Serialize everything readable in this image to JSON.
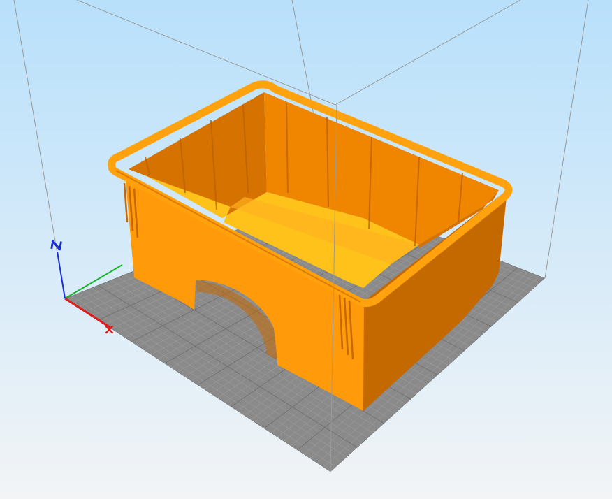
{
  "viewport": {
    "background_top": "#b8e0fb",
    "background_bottom": "#f2f4f6"
  },
  "bed": {
    "fill": "#8a8a8a",
    "grid_minor": "#a3a3a3",
    "grid_major": "#6f6f6f",
    "build_volume_line": "#9a9a9a"
  },
  "model": {
    "color": "#ff9a0a",
    "color_dark": "#d67300",
    "color_darker": "#c46800",
    "color_light": "#ffb21f",
    "color_floor": "#ffc21a"
  },
  "axes": {
    "x_color": "#e01818",
    "y_color": "#16b32a",
    "z_color": "#1a2fd6",
    "x_symbol": "×",
    "z_symbol": "Z"
  }
}
